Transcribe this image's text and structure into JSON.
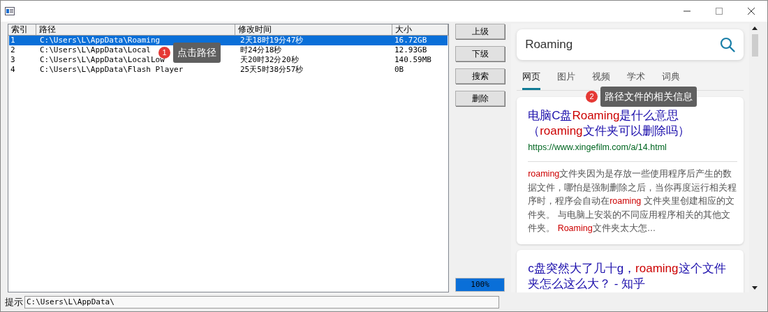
{
  "table": {
    "columns": [
      "索引",
      "路径",
      "修改时间",
      "大小"
    ],
    "rows": [
      {
        "selected": true,
        "cells": [
          "1",
          "C:\\Users\\L\\AppData\\Roaming",
          "2天18时19分47秒",
          "16.72GB"
        ]
      },
      {
        "selected": false,
        "cells": [
          "2",
          "C:\\Users\\L\\AppData\\Local",
          "时24分18秒",
          "12.93GB"
        ]
      },
      {
        "selected": false,
        "cells": [
          "3",
          "C:\\Users\\L\\AppData\\LocalLow",
          "天20时32分20秒",
          "140.59MB"
        ]
      },
      {
        "selected": false,
        "cells": [
          "4",
          "C:\\Users\\L\\AppData\\Flash Player",
          "25天5时38分57秒",
          "0B"
        ]
      }
    ]
  },
  "callouts": [
    {
      "number": "1",
      "text": "点击路径"
    },
    {
      "number": "2",
      "text": "路径文件的相关信息"
    }
  ],
  "buttons": [
    "上级",
    "下级",
    "搜索",
    "删除"
  ],
  "progress": {
    "level": 1,
    "reading": "100%"
  },
  "browser": {
    "search_value": "Roaming",
    "tabs": [
      {
        "label": "网页",
        "selected": true
      },
      {
        "label": "图片",
        "selected": false
      },
      {
        "label": "视频",
        "selected": false
      },
      {
        "label": "学术",
        "selected": false
      },
      {
        "label": "词典",
        "selected": false
      }
    ],
    "results": [
      {
        "title": [
          {
            "text": "电脑C盘",
            "highlight": false
          },
          {
            "text": "Roaming",
            "highlight": true
          },
          {
            "text": "是什么意思（",
            "highlight": false
          },
          {
            "text": "roaming",
            "highlight": true
          },
          {
            "text": "文件夹可以删除吗）",
            "highlight": false
          }
        ],
        "url": "https://www.xingefilm.com/a/14.html",
        "snippet": [
          {
            "text": "roaming",
            "highlight": true
          },
          {
            "text": "文件夹因为是存放一些使用程序后产生的数据文件，哪怕是强制删除之后，当你再度运行相关程序时，程序会自动在",
            "highlight": false
          },
          {
            "text": "roaming",
            "highlight": true
          },
          {
            "text": " 文件夹里创建相应的文件夹。 与电脑上安装的不同应用程序相关的其他文件夹。 ",
            "highlight": false
          },
          {
            "text": "Roaming",
            "highlight": true
          },
          {
            "text": "文件夹太大怎…",
            "highlight": false
          }
        ]
      },
      {
        "title": [
          {
            "text": "c盘突然大了几十g，",
            "highlight": false
          },
          {
            "text": "roaming",
            "highlight": true
          },
          {
            "text": "这个文件夹怎么这么大？ - 知乎",
            "highlight": false
          }
        ]
      }
    ]
  },
  "status": {
    "label": "提示",
    "value": "C:\\Users\\L\\AppData\\"
  }
}
